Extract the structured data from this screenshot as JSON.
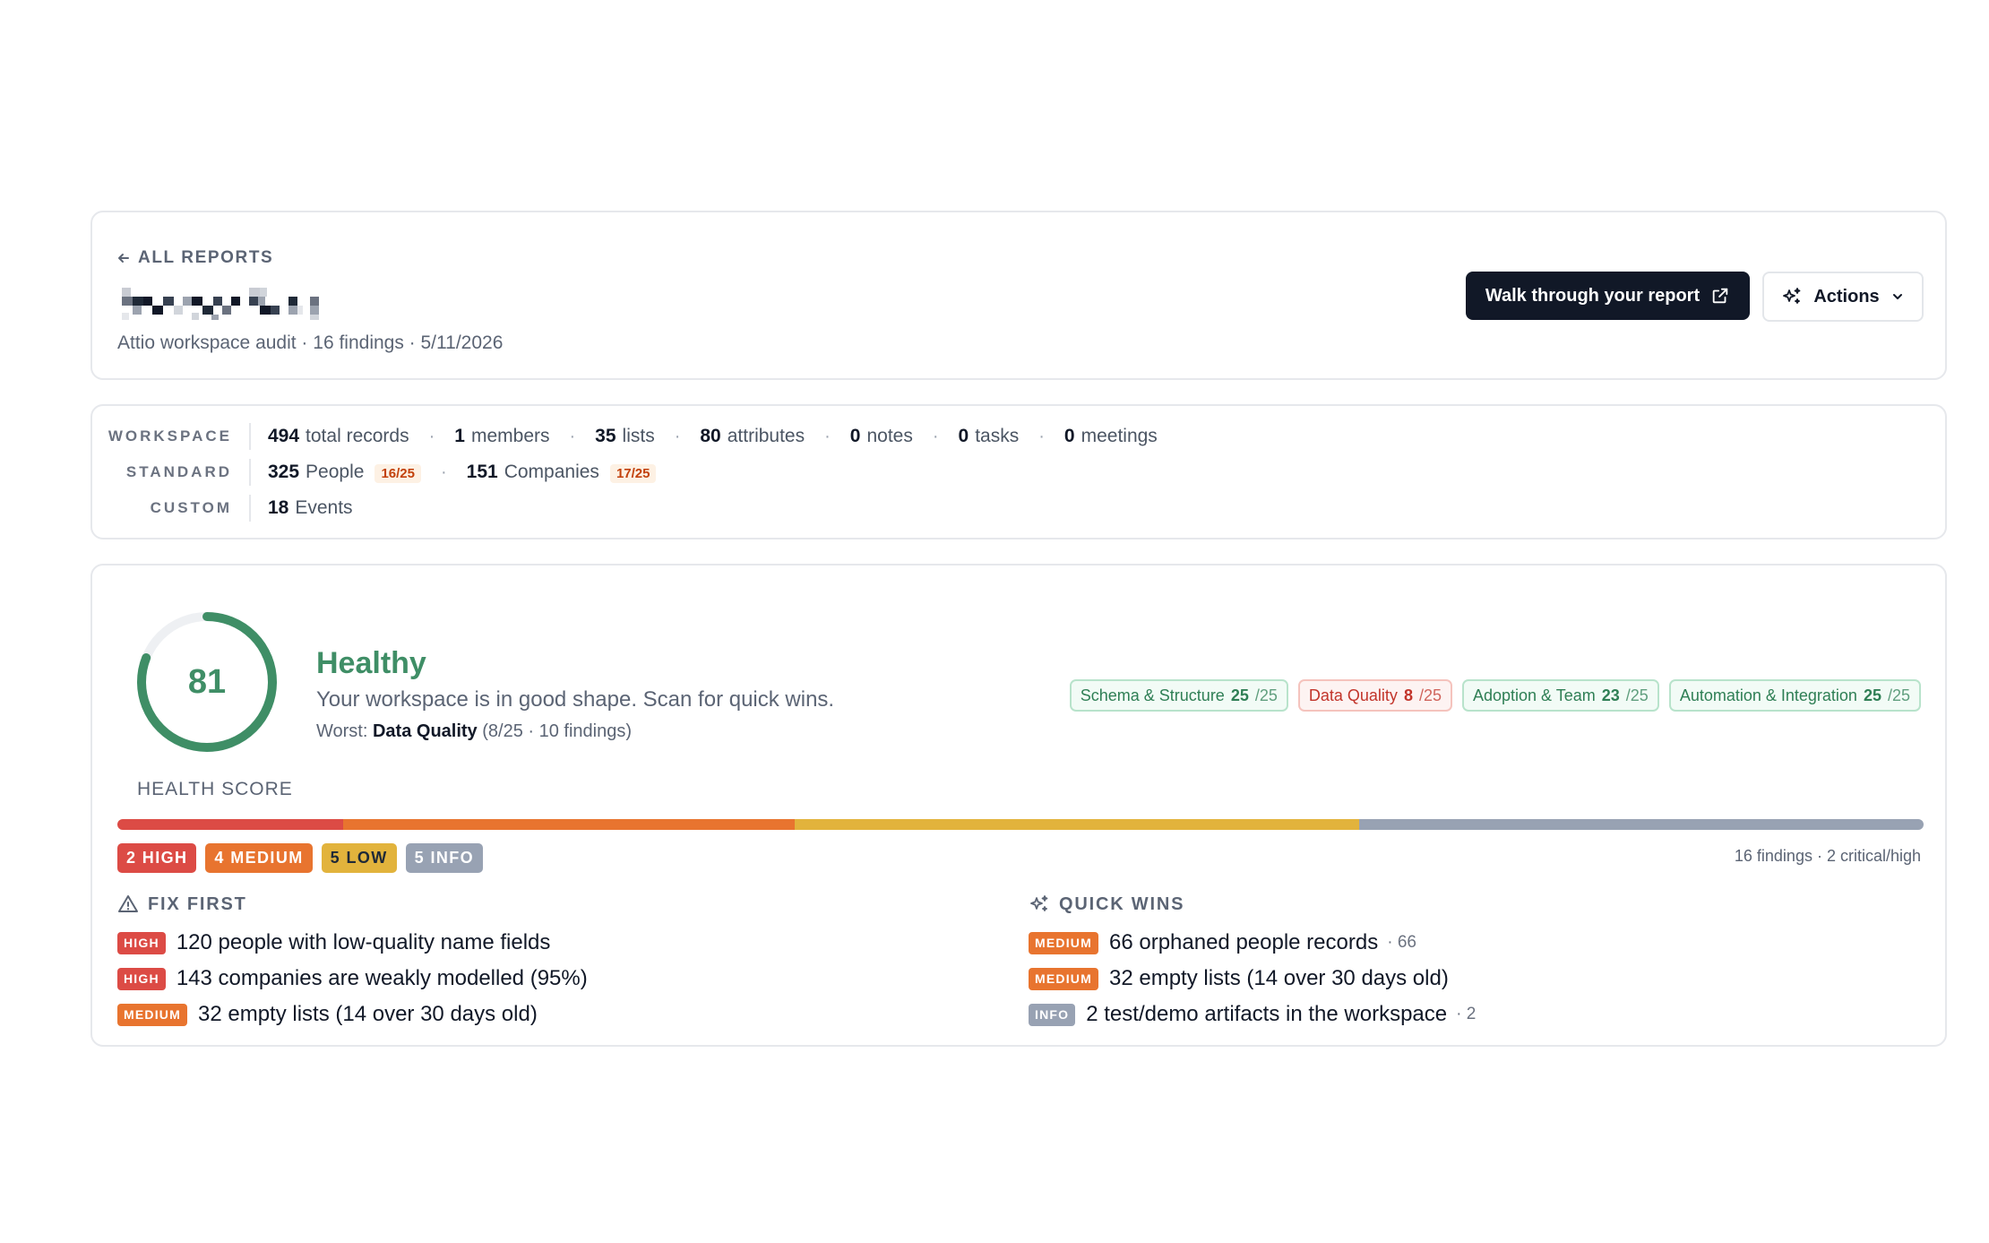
{
  "header": {
    "back_label": "ALL REPORTS",
    "subtitle": "Attio workspace audit · 16 findings · 5/11/2026",
    "walk_button": "Walk through your report",
    "actions_button": "Actions"
  },
  "stats": {
    "workspace": {
      "label": "WORKSPACE",
      "items": [
        {
          "value": "494",
          "label": "total records"
        },
        {
          "value": "1",
          "label": "members"
        },
        {
          "value": "35",
          "label": "lists"
        },
        {
          "value": "80",
          "label": "attributes"
        },
        {
          "value": "0",
          "label": "notes"
        },
        {
          "value": "0",
          "label": "tasks"
        },
        {
          "value": "0",
          "label": "meetings"
        }
      ]
    },
    "standard": {
      "label": "STANDARD",
      "items": [
        {
          "value": "325",
          "label": "People",
          "score": "16/25"
        },
        {
          "value": "151",
          "label": "Companies",
          "score": "17/25"
        }
      ]
    },
    "custom": {
      "label": "CUSTOM",
      "items": [
        {
          "value": "18",
          "label": "Events"
        }
      ]
    }
  },
  "health": {
    "score": "81",
    "score_fraction": 0.81,
    "score_label": "HEALTH SCORE",
    "status": "Healthy",
    "description": "Your workspace is in good shape. Scan for quick wins.",
    "worst_prefix": "Worst:",
    "worst_category": "Data Quality",
    "worst_detail": "(8/25 · 10 findings)",
    "colors": {
      "good": "#3f8e66",
      "ring_track": "#eef0f3"
    },
    "categories": [
      {
        "name": "Schema & Structure",
        "score": "25",
        "max": "/25",
        "state": "good"
      },
      {
        "name": "Data Quality",
        "score": "8",
        "max": "/25",
        "state": "bad"
      },
      {
        "name": "Adoption & Team",
        "score": "23",
        "max": "/25",
        "state": "good"
      },
      {
        "name": "Automation & Integration",
        "score": "25",
        "max": "/25",
        "state": "good"
      }
    ],
    "severity": [
      {
        "label": "2 HIGH",
        "count": 2,
        "color": "#dc4b45"
      },
      {
        "label": "4 MEDIUM",
        "count": 4,
        "color": "#e8742f"
      },
      {
        "label": "5 LOW",
        "count": 5,
        "color": "#e2b33c"
      },
      {
        "label": "5 INFO",
        "count": 5,
        "color": "#98a2b3"
      }
    ],
    "severity_summary": "16 findings · 2 critical/high"
  },
  "fix_first": {
    "title": "FIX FIRST",
    "items": [
      {
        "tag": "HIGH",
        "text": "120 people with low-quality name fields",
        "count": ""
      },
      {
        "tag": "HIGH",
        "text": "143 companies are weakly modelled (95%)",
        "count": ""
      },
      {
        "tag": "MEDIUM",
        "text": "32 empty lists (14 over 30 days old)",
        "count": ""
      }
    ]
  },
  "quick_wins": {
    "title": "QUICK WINS",
    "items": [
      {
        "tag": "MEDIUM",
        "text": "66 orphaned people records",
        "count": "· 66"
      },
      {
        "tag": "MEDIUM",
        "text": "32 empty lists (14 over 30 days old)",
        "count": ""
      },
      {
        "tag": "INFO",
        "text": "2 test/demo artifacts in the workspace",
        "count": "· 2"
      }
    ]
  },
  "tag_colors": {
    "HIGH": "#dc4b45",
    "MEDIUM": "#e8742f",
    "LOW": "#e2b33c",
    "INFO": "#98a2b3"
  }
}
